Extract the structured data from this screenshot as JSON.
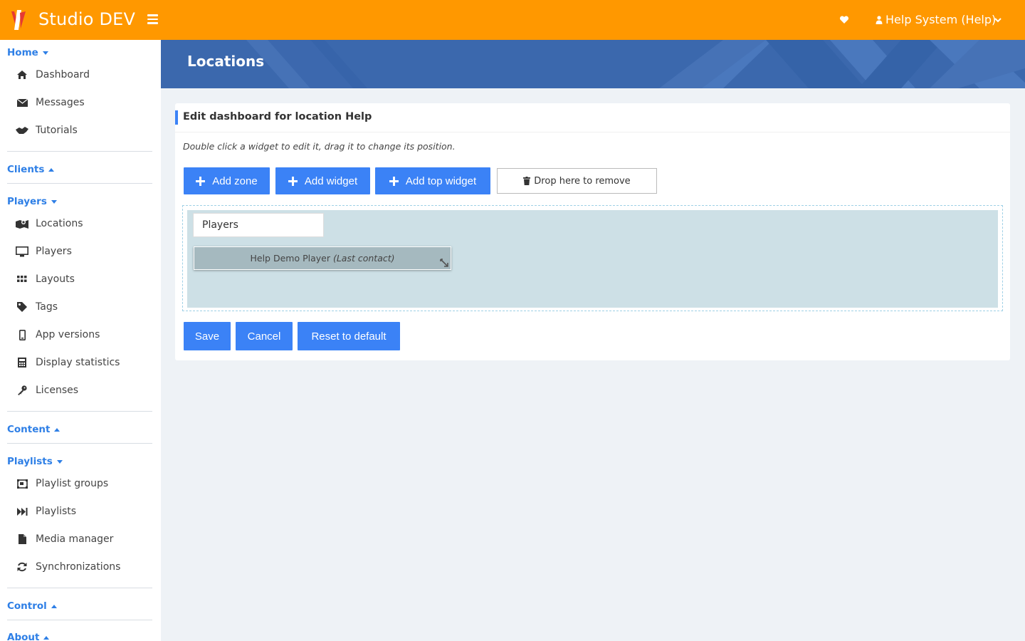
{
  "app": {
    "brand": "Studio DEV",
    "user_label": "Help System (Help)"
  },
  "sidebar": {
    "home": {
      "label": "Home",
      "items": [
        "Dashboard",
        "Messages",
        "Tutorials"
      ]
    },
    "clients": {
      "label": "Clients"
    },
    "players": {
      "label": "Players",
      "items": [
        "Locations",
        "Players",
        "Layouts",
        "Tags",
        "App versions",
        "Display statistics",
        "Licenses"
      ]
    },
    "content": {
      "label": "Content"
    },
    "playlists": {
      "label": "Playlists",
      "items": [
        "Playlist groups",
        "Playlists",
        "Media manager",
        "Synchronizations"
      ]
    },
    "control": {
      "label": "Control"
    },
    "about": {
      "label": "About"
    }
  },
  "page": {
    "title": "Locations"
  },
  "card": {
    "title": "Edit dashboard for location Help",
    "hint": "Double click a widget to edit it, drag it to change its position.",
    "buttons": {
      "add_zone": "Add zone",
      "add_widget": "Add widget",
      "add_top_widget": "Add top widget",
      "drop_remove": "Drop here to remove"
    },
    "zone": {
      "label": "Players",
      "widget_name": "Help Demo Player",
      "widget_suffix": "(Last contact)"
    },
    "actions": {
      "save": "Save",
      "cancel": "Cancel",
      "reset": "Reset to default"
    }
  },
  "colors": {
    "topbar": "#ff9800",
    "accent": "#3b82f6",
    "link": "#2e7fe6",
    "band": "#3b68ad"
  }
}
